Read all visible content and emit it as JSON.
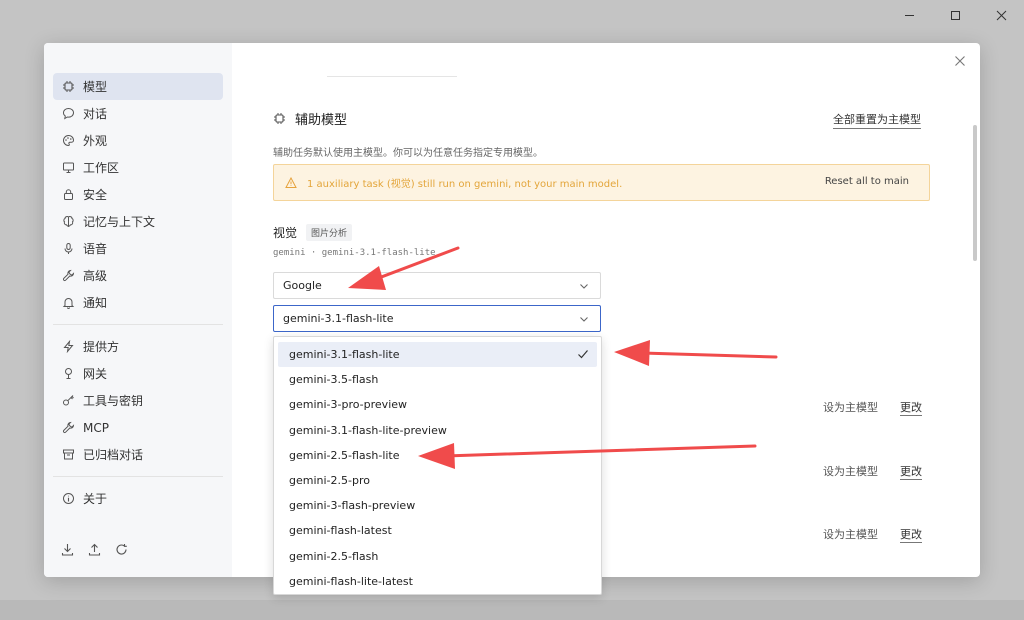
{
  "sidebar": {
    "items": [
      {
        "label": "模型",
        "icon": "chip-icon",
        "active": true
      },
      {
        "label": "对话",
        "icon": "chat-bubble-icon"
      },
      {
        "label": "外观",
        "icon": "palette-icon"
      },
      {
        "label": "工作区",
        "icon": "monitor-icon"
      },
      {
        "label": "安全",
        "icon": "lock-icon"
      },
      {
        "label": "记忆与上下文",
        "icon": "brain-icon"
      },
      {
        "label": "语音",
        "icon": "microphone-icon"
      },
      {
        "label": "高级",
        "icon": "wrench-icon"
      },
      {
        "label": "通知",
        "icon": "bell-icon"
      }
    ],
    "items2": [
      {
        "label": "提供方",
        "icon": "bolt-icon"
      },
      {
        "label": "网关",
        "icon": "gateway-icon"
      },
      {
        "label": "工具与密钥",
        "icon": "key-icon"
      },
      {
        "label": "MCP",
        "icon": "wrench-icon"
      },
      {
        "label": "已归档对话",
        "icon": "archive-icon"
      }
    ],
    "items3": [
      {
        "label": "关于",
        "icon": "info-icon"
      }
    ],
    "bottom_icons": [
      "download-icon",
      "upload-icon",
      "refresh-icon"
    ]
  },
  "section": {
    "title": "辅助模型",
    "reset_all_label": "全部重置为主模型",
    "description": "辅助任务默认使用主模型。你可以为任意任务指定专用模型。",
    "warning_text": "1 auxiliary task (视觉) still run on gemini, not your main model.",
    "warning_button": "Reset all to main"
  },
  "vision": {
    "title": "视觉",
    "tag": "图片分析",
    "subtitle": "gemini · gemini-3.1-flash-lite",
    "provider_value": "Google",
    "model_value": "gemini-3.1-flash-lite"
  },
  "rows": [
    {
      "set_main": "设为主模型",
      "change": "更改"
    },
    {
      "set_main": "设为主模型",
      "change": "更改"
    },
    {
      "set_main": "设为主模型",
      "change": "更改"
    }
  ],
  "dropdown": {
    "options": [
      "gemini-3.1-flash-lite",
      "gemini-3.5-flash",
      "gemini-3-pro-preview",
      "gemini-3.1-flash-lite-preview",
      "gemini-2.5-flash-lite",
      "gemini-2.5-pro",
      "gemini-3-flash-preview",
      "gemini-flash-latest",
      "gemini-2.5-flash",
      "gemini-flash-lite-latest"
    ],
    "selected_index": 0
  },
  "colors": {
    "accent": "#3c66c9",
    "warning_bg": "#fdf3e1",
    "warning_text": "#e3a53a",
    "annotation": "#f04b4b"
  }
}
